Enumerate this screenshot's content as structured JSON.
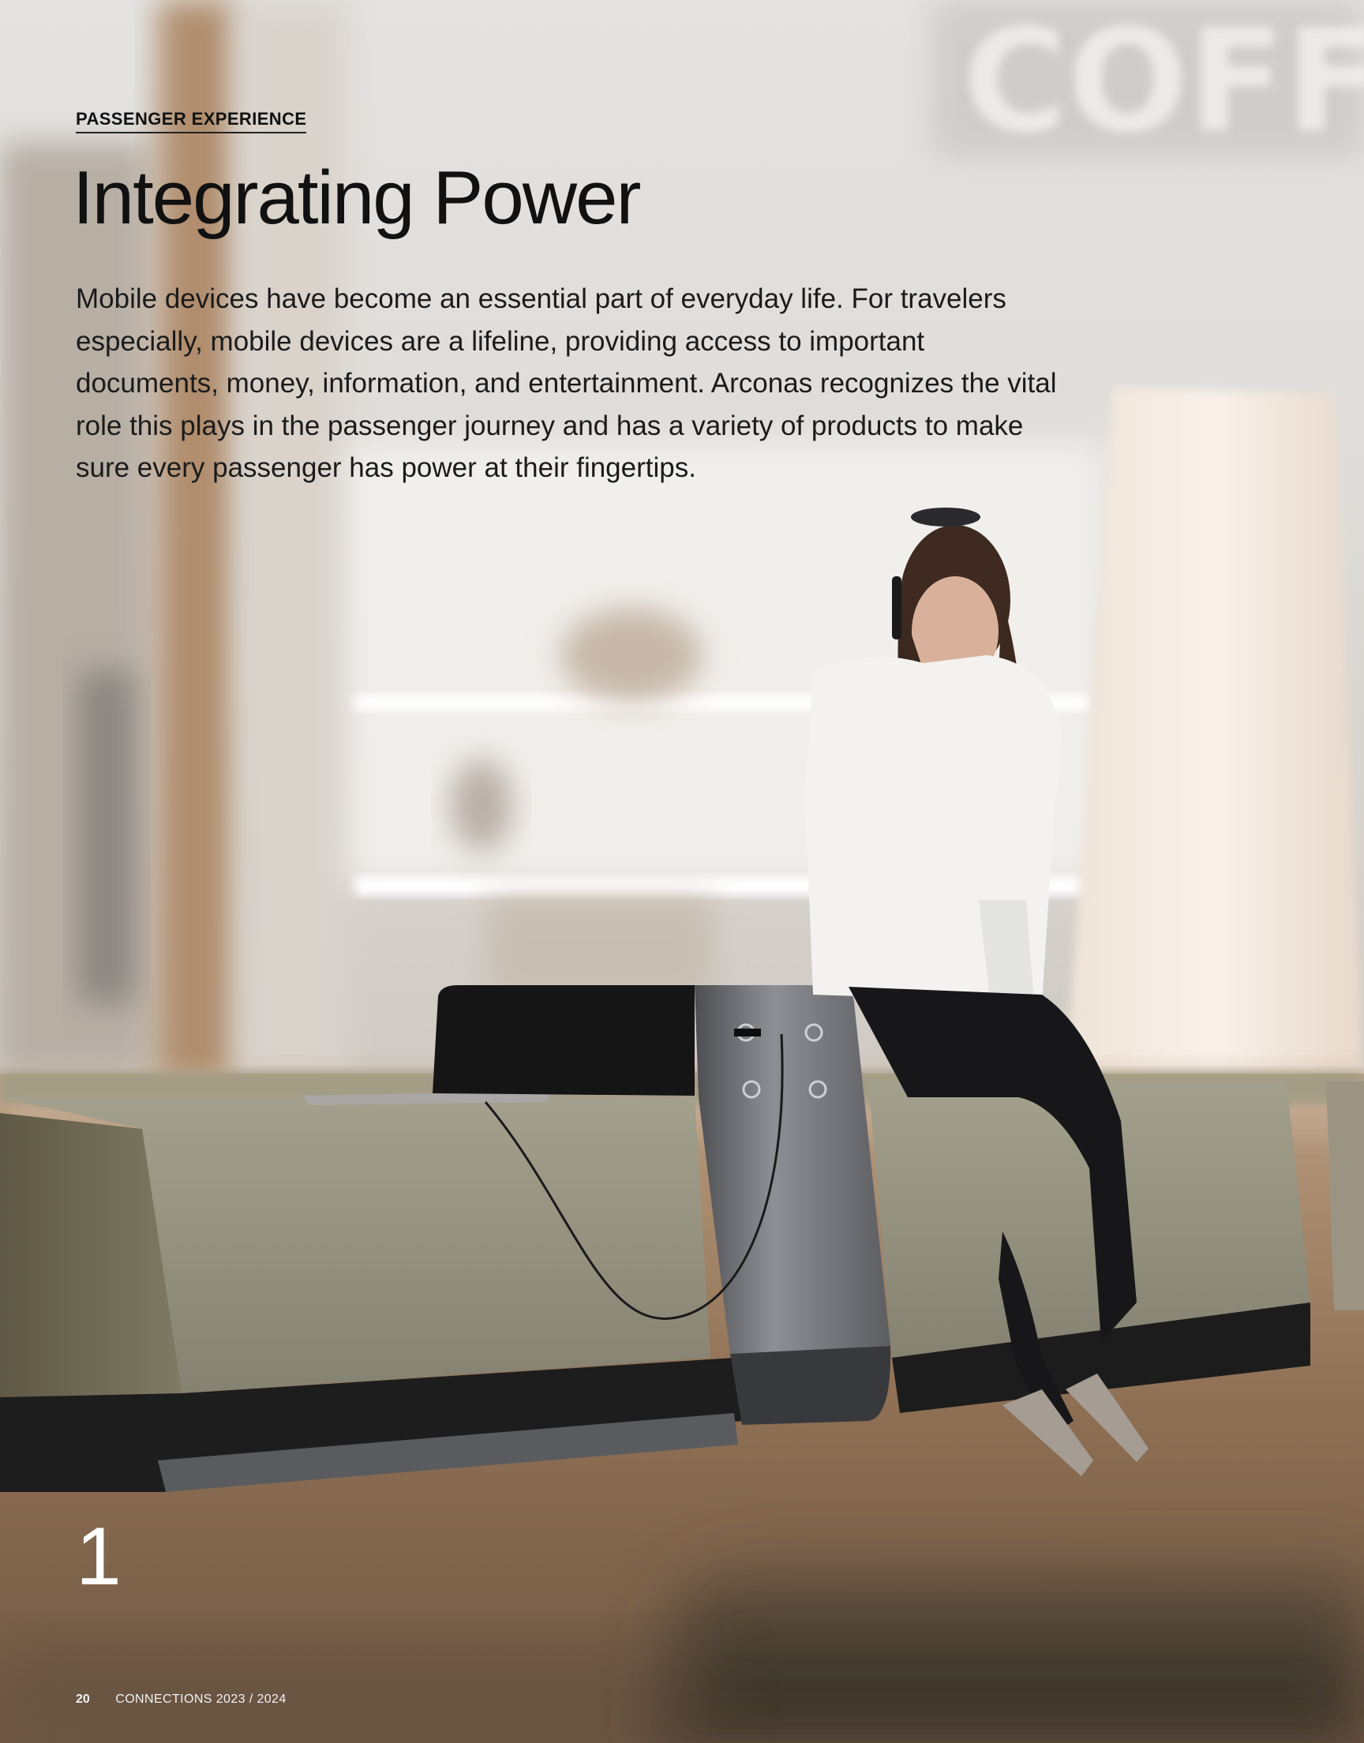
{
  "header": {
    "section_label": "PASSENGER EXPERIENCE",
    "title": "Integrating Power"
  },
  "body": {
    "paragraph": "Mobile devices have become an essential part of everyday life. For travelers especially, mobile devices are a lifeline, providing access to important documents, money, information, and entertainment. Arconas recognizes the vital role this plays in the passenger journey and has a variety of products to make sure every passenger has power at their fingertips."
  },
  "photo": {
    "background_sign_text": "COFFE",
    "feature_number": "1"
  },
  "footer": {
    "page_number": "20",
    "publication": "CONNECTIONS 2023 / 2024"
  }
}
